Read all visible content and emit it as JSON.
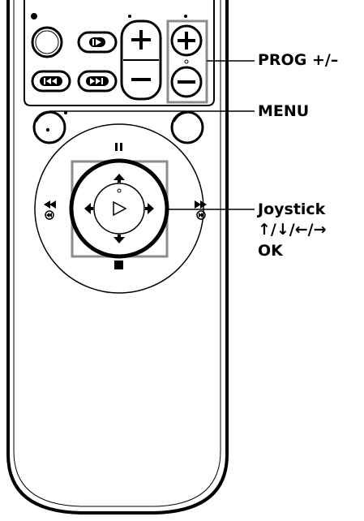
{
  "labels": {
    "prog": "PROG +/–",
    "menu": "MENU",
    "joystick": "Joystick",
    "arrows": "↑/↓/←/→",
    "ok": "OK"
  },
  "colors": {
    "ink": "#000000",
    "highlight_box": "#8c8c8c",
    "background": "#ffffff"
  },
  "icons": {
    "play": "play-triangle-icon",
    "pause": "pause-icon",
    "stop": "stop-icon",
    "rewind": "rewind-icon",
    "fast_forward": "fast-forward-icon",
    "previous": "previous-track-icon",
    "next": "next-track-icon",
    "slow": "slow-play-icon",
    "plus": "plus-icon",
    "minus": "minus-icon"
  }
}
